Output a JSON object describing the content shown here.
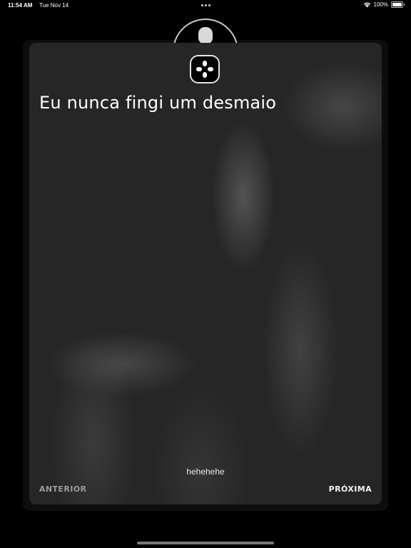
{
  "status_bar": {
    "time": "11:54 AM",
    "date": "Tue Nov 14",
    "battery_percent": "100%",
    "battery_level": 1.0
  },
  "card": {
    "icon": "dpad-icon",
    "title": "Eu nunca fingi um desmaio",
    "note": "hehehehe",
    "prev_label": "ANTERIOR",
    "next_label": "PRÓXIMA"
  },
  "colors": {
    "background": "#000000",
    "card": "#262626",
    "text": "#ffffff",
    "muted": "#9a9a9a"
  }
}
